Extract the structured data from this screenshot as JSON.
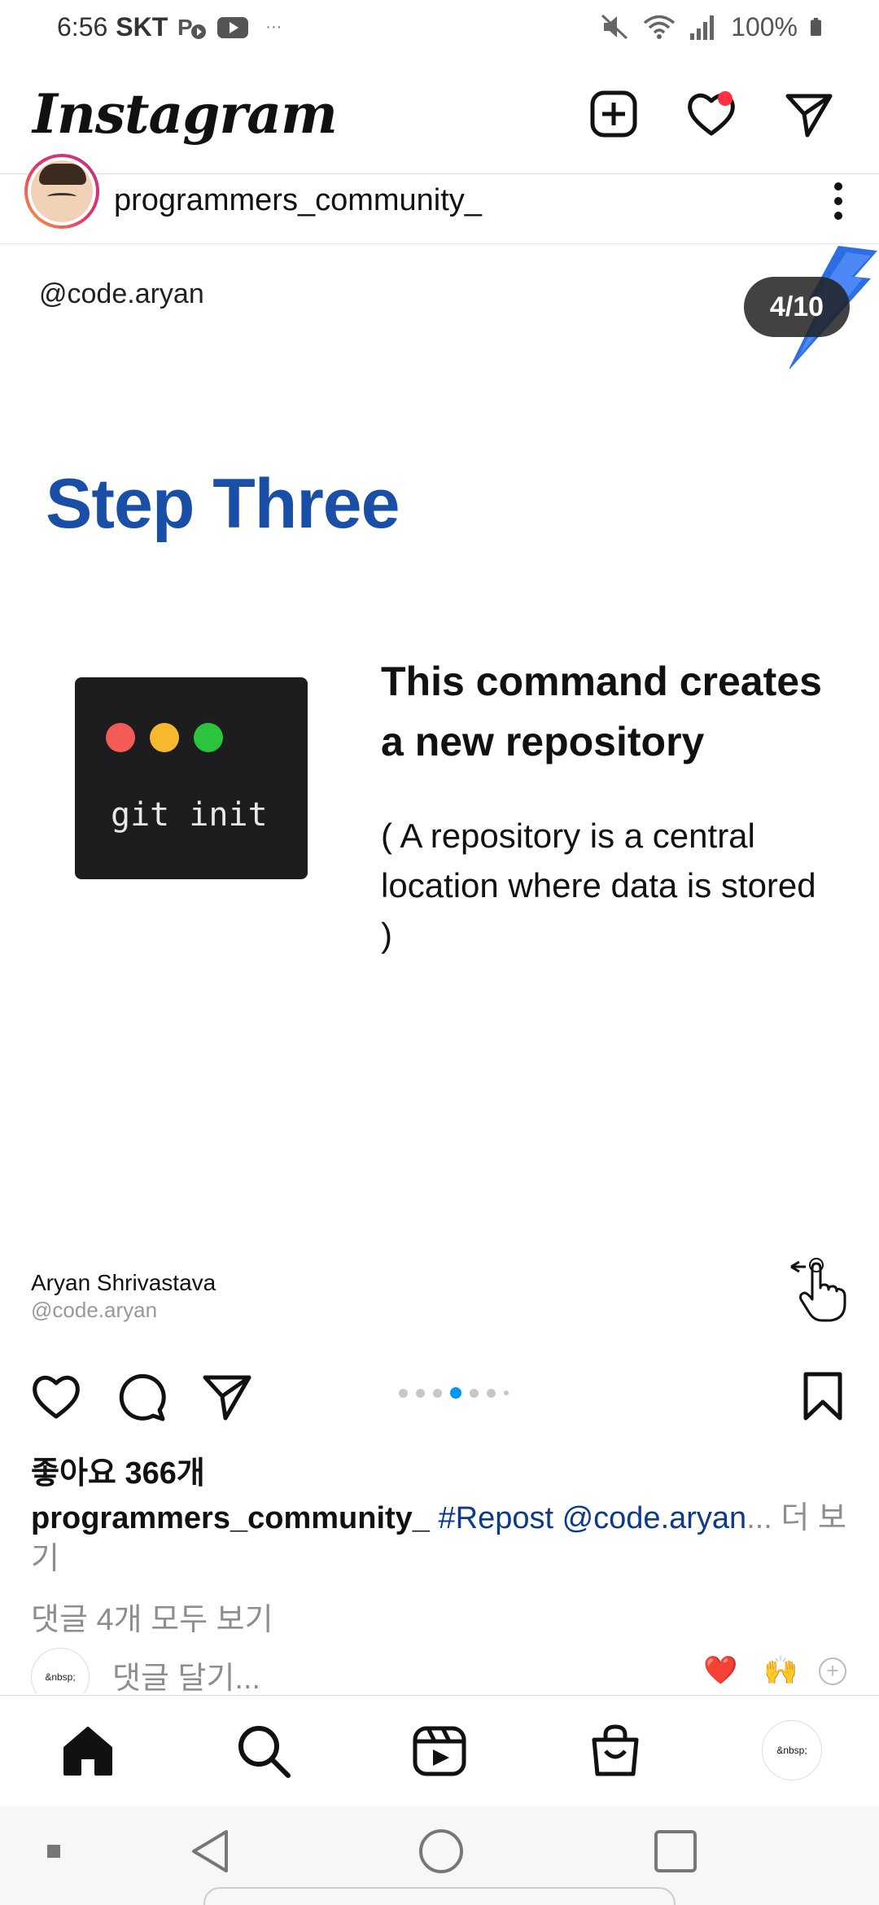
{
  "status_bar": {
    "time": "6:56",
    "carrier": "SKT",
    "extra": "···",
    "battery": "100%"
  },
  "header": {
    "logo": "Instagram"
  },
  "post": {
    "username": "programmers_community_",
    "media": {
      "handle": "@code.aryan",
      "counter": "4/10",
      "title": "Step Three",
      "terminal_command": "git init",
      "command_title": "This command creates a new repository",
      "command_desc": "( A repository is a central location where data is stored )",
      "author_name": "Aryan Shrivastava",
      "author_handle": "@code.aryan"
    },
    "likes": "좋아요 366개",
    "caption_user": "programmers_community_",
    "caption_tag": "#Repost @code.aryan",
    "caption_ellipsis": "...",
    "caption_more": " 더 보기",
    "view_comments": "댓글 4개 모두 보기",
    "comment_avatar_text": "&nbsp;",
    "comment_placeholder": "댓글 달기...",
    "quick_reactions": [
      "❤️",
      "🙌"
    ],
    "carousel": {
      "total": 7,
      "active": 3
    }
  },
  "bottom_nav": {
    "profile_text": "&nbsp;"
  }
}
